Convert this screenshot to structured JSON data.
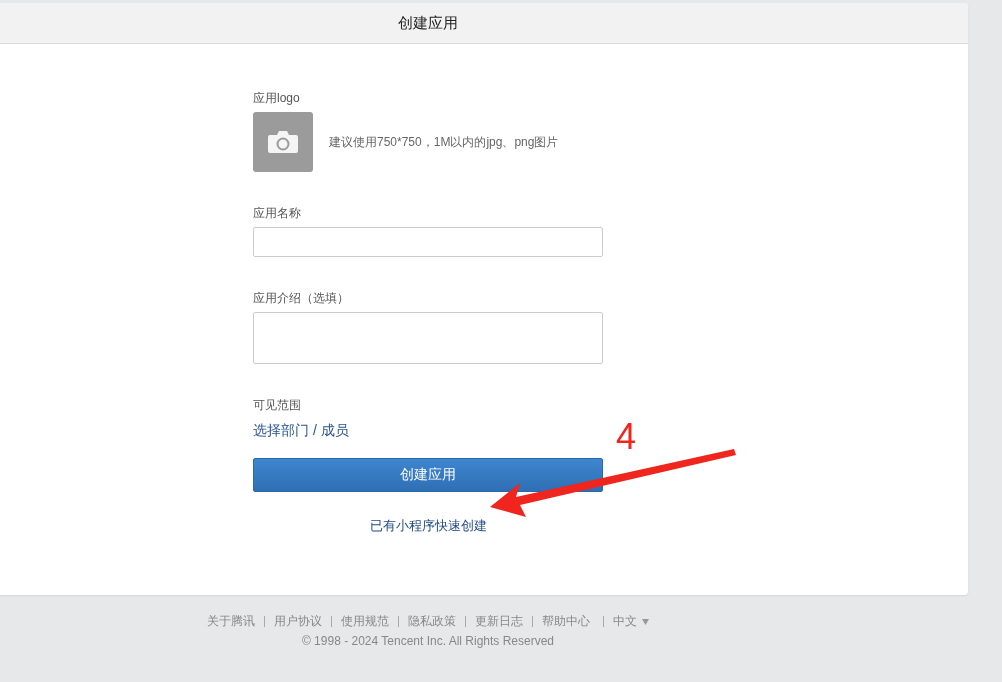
{
  "dialog": {
    "title": "创建应用"
  },
  "form": {
    "logo": {
      "label": "应用logo",
      "hint": "建议使用750*750，1M以内的jpg、png图片"
    },
    "name": {
      "label": "应用名称"
    },
    "intro": {
      "label": "应用介绍（选填）"
    },
    "visibility": {
      "label": "可见范围",
      "link": "选择部门 / 成员"
    },
    "submit": "创建应用",
    "quick_create": "已有小程序快速创建"
  },
  "annotation": {
    "label": "4"
  },
  "footer": {
    "links": [
      "关于腾讯",
      "用户协议",
      "使用规范",
      "隐私政策",
      "更新日志",
      "帮助中心"
    ],
    "language": "中文",
    "copyright": "© 1998 - 2024 Tencent Inc. All Rights Reserved"
  }
}
